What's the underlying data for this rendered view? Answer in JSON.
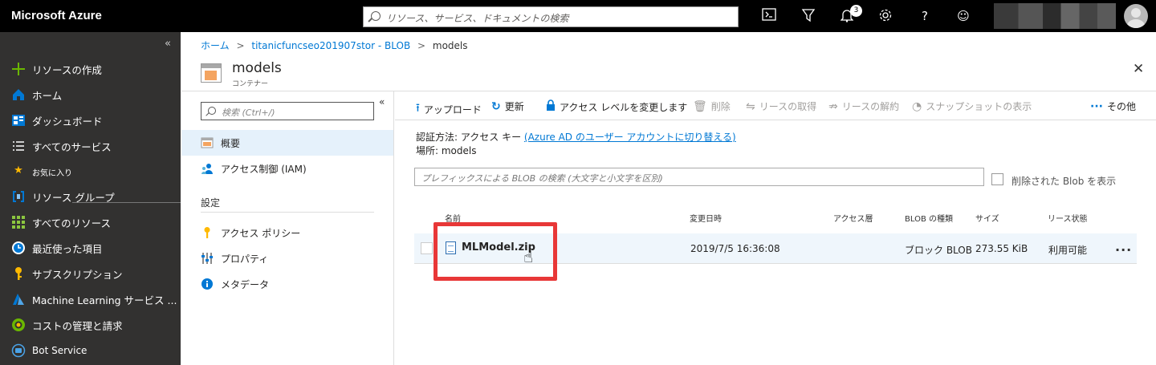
{
  "topbar": {
    "brand": "Microsoft Azure",
    "search_placeholder": "リソース、サービス、ドキュメントの検索",
    "notification_count": "3"
  },
  "sidebar": {
    "collapse": "«",
    "items": [
      {
        "label": "リソースの作成",
        "icon": "plus-icon",
        "color": "#6bb700"
      },
      {
        "label": "ホーム",
        "icon": "home-icon",
        "color": "#0078d4"
      },
      {
        "label": "ダッシュボード",
        "icon": "dashboard-icon",
        "color": "#0078d4"
      },
      {
        "label": "すべてのサービス",
        "icon": "list-icon",
        "color": "#ffffff"
      },
      {
        "label": "お気に入り",
        "icon": "star-icon",
        "color": "#ffb900"
      },
      {
        "label": "リソース グループ",
        "icon": "resource-group-icon",
        "color": "#0078d4"
      },
      {
        "label": "すべてのリソース",
        "icon": "grid-icon",
        "color": "#8cc63f"
      },
      {
        "label": "最近使った項目",
        "icon": "clock-icon",
        "color": "#0078d4"
      },
      {
        "label": "サブスクリプション",
        "icon": "key-icon",
        "color": "#ffb900"
      },
      {
        "label": "Machine Learning サービス ...",
        "icon": "flask-icon",
        "color": "#0078d4"
      },
      {
        "label": "コストの管理と請求",
        "icon": "cost-icon",
        "color": "#6bb700"
      },
      {
        "label": "Bot Service",
        "icon": "bot-icon",
        "color": "#0078d4"
      }
    ]
  },
  "breadcrumb": {
    "home": "ホーム",
    "storage": "titanicfuncseo201907stor - BLOB",
    "current": "models",
    "sep": ">"
  },
  "header": {
    "title": "models",
    "subtitle": "コンテナー"
  },
  "leftnav": {
    "search_placeholder": "検索 (Ctrl+/)",
    "collapse": "«",
    "items": [
      {
        "label": "概要"
      },
      {
        "label": "アクセス制御 (IAM)"
      }
    ],
    "section": "設定",
    "settings_items": [
      {
        "label": "アクセス ポリシー"
      },
      {
        "label": "プロパティ"
      },
      {
        "label": "メタデータ"
      }
    ]
  },
  "toolbar": {
    "upload": "アップロード",
    "refresh": "更新",
    "access_level": "アクセス レベルを変更します",
    "delete": "削除",
    "acquire_lease": "リースの取得",
    "break_lease": "リースの解約",
    "snapshot": "スナップショットの表示",
    "more": "その他"
  },
  "info": {
    "auth_label": "認証方法: アクセス キー",
    "auth_link": "(Azure AD のユーザー アカウントに切り替える)",
    "location": "場所: models"
  },
  "filter": {
    "placeholder": "プレフィックスによる BLOB の検索 (大文字と小文字を区別)",
    "show_deleted": "削除された Blob を表示"
  },
  "table": {
    "headers": [
      "名前",
      "変更日時",
      "アクセス層",
      "BLOB の種類",
      "サイズ",
      "リース状態"
    ],
    "rows": [
      {
        "name": "MLModel.zip",
        "modified": "2019/7/5 16:36:08",
        "tier": "",
        "type": "ブロック BLOB",
        "size": "273.55 KiB",
        "lease": "利用可能"
      }
    ]
  },
  "colors": {
    "accent": "#0078d4",
    "highlight": "#e83737"
  }
}
